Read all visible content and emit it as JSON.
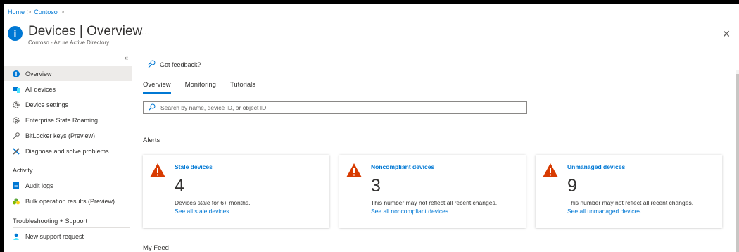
{
  "breadcrumb": {
    "home": "Home",
    "sep1": ">",
    "contoso": "Contoso",
    "sep2": ">"
  },
  "header": {
    "title": "Devices | Overview",
    "subtitle": "Contoso - Azure Active Directory",
    "more": "···",
    "close": "✕",
    "icon": "info-icon"
  },
  "sidebar": {
    "collapse": "«",
    "items": [
      {
        "label": "Overview",
        "icon": "info-icon"
      },
      {
        "label": "All devices",
        "icon": "devices-icon"
      },
      {
        "label": "Device settings",
        "icon": "gear-icon"
      },
      {
        "label": "Enterprise State Roaming",
        "icon": "gear-icon"
      },
      {
        "label": "BitLocker keys (Preview)",
        "icon": "key-icon"
      },
      {
        "label": "Diagnose and solve problems",
        "icon": "wrench-icon"
      }
    ],
    "activity_heading": "Activity",
    "activity_items": [
      {
        "label": "Audit logs",
        "icon": "log-icon"
      },
      {
        "label": "Bulk operation results (Preview)",
        "icon": "bulk-icon"
      }
    ],
    "support_heading": "Troubleshooting + Support",
    "support_items": [
      {
        "label": "New support request",
        "icon": "person-icon"
      }
    ]
  },
  "main": {
    "feedback": "Got feedback?",
    "tabs": [
      "Overview",
      "Monitoring",
      "Tutorials"
    ],
    "search_placeholder": "Search by name, device ID, or object ID",
    "alerts_heading": "Alerts",
    "cards": [
      {
        "title": "Stale devices",
        "count": "4",
        "desc": "Devices stale for 6+ months.",
        "link": "See all stale devices"
      },
      {
        "title": "Noncompliant devices",
        "count": "3",
        "desc": "This number may not reflect all recent changes.",
        "link": "See all noncompliant devices"
      },
      {
        "title": "Unmanaged devices",
        "count": "9",
        "desc": "This number may not reflect all recent changes.",
        "link": "See all unmanaged devices"
      }
    ],
    "my_feed": "My Feed"
  },
  "colors": {
    "accent": "#0078d4",
    "warning": "#d83b01",
    "active_nav": "#edebe9"
  }
}
